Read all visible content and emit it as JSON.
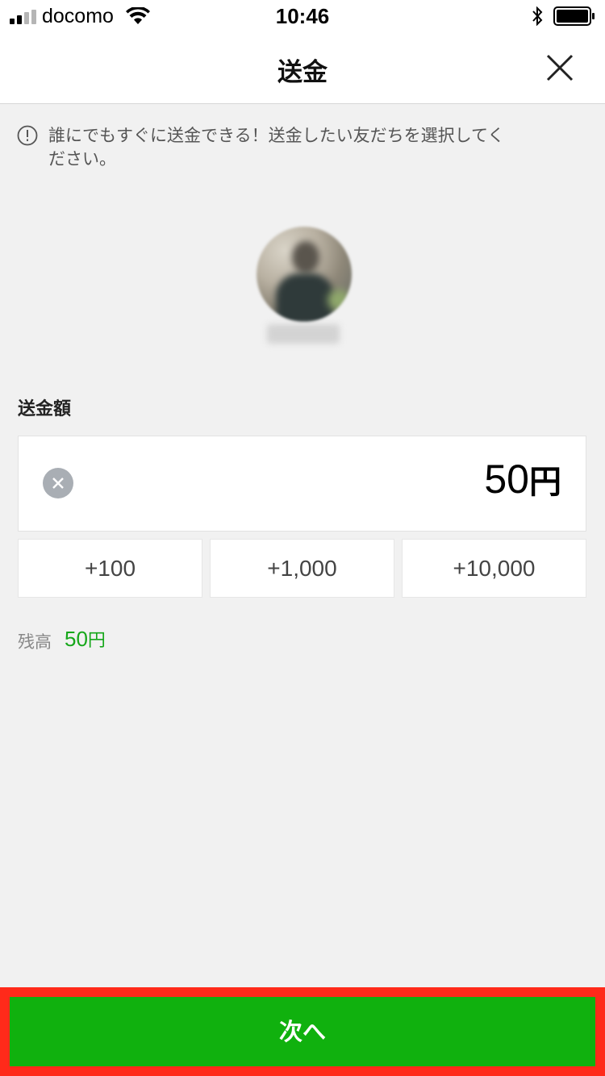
{
  "status_bar": {
    "carrier": "docomo",
    "time": "10:46"
  },
  "header": {
    "title": "送金"
  },
  "notice": {
    "text": "誰にでもすぐに送金できる！送金したい友だちを選択してください。"
  },
  "amount": {
    "label": "送金額",
    "value": "50",
    "unit": "円"
  },
  "quick_add": {
    "items": [
      "+100",
      "+1,000",
      "+10,000"
    ]
  },
  "balance": {
    "label": "残高",
    "value": "50",
    "unit": "円"
  },
  "footer": {
    "next_label": "次へ"
  },
  "colors": {
    "brand_green": "#10b10e",
    "balance_green": "#16a71a",
    "highlight_red": "#ff2a1a"
  }
}
